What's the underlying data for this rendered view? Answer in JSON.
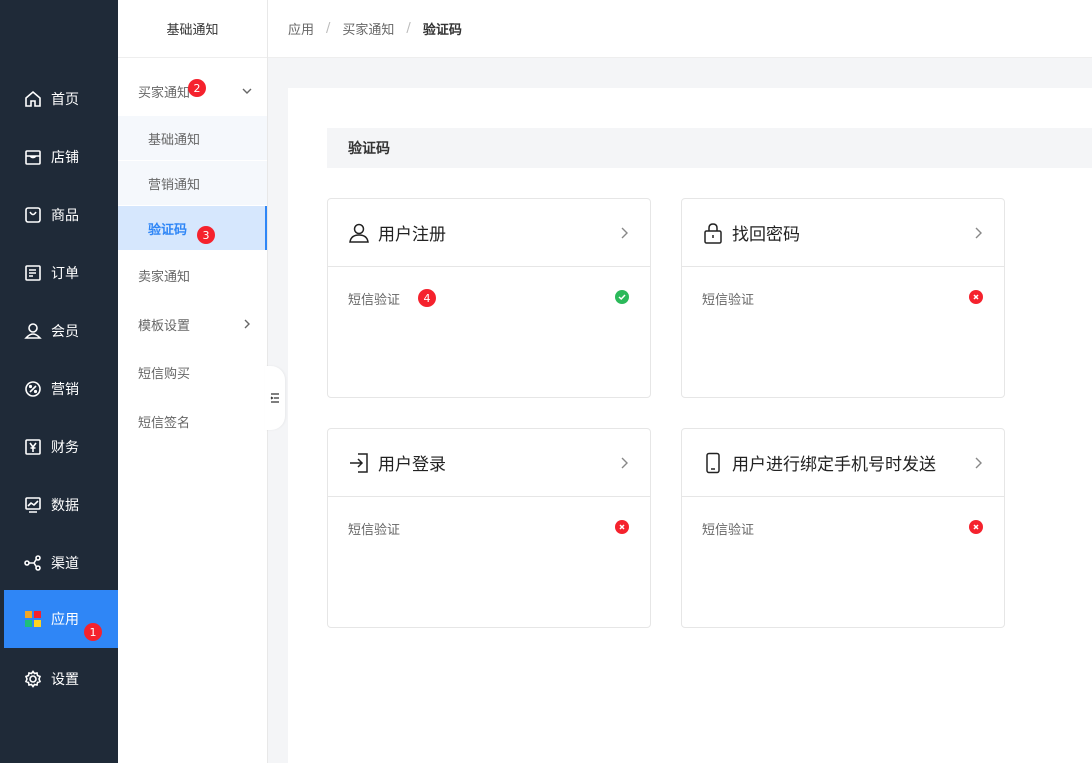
{
  "sidebar": {
    "items": [
      {
        "label": "首页",
        "icon": "home-icon"
      },
      {
        "label": "店铺",
        "icon": "store-icon"
      },
      {
        "label": "商品",
        "icon": "bag-icon"
      },
      {
        "label": "订单",
        "icon": "order-icon"
      },
      {
        "label": "会员",
        "icon": "user-icon"
      },
      {
        "label": "营销",
        "icon": "discount-icon"
      },
      {
        "label": "财务",
        "icon": "yuan-icon"
      },
      {
        "label": "数据",
        "icon": "chart-icon"
      },
      {
        "label": "渠道",
        "icon": "share-icon"
      },
      {
        "label": "应用",
        "icon": "apps-icon"
      },
      {
        "label": "设置",
        "icon": "gear-icon"
      }
    ],
    "active_index": 9,
    "accent": "#2f86f6",
    "background": "#1f2a38"
  },
  "subnav": {
    "header": "基础通知",
    "items": [
      {
        "label": "买家通知"
      },
      {
        "label": "基础通知"
      },
      {
        "label": "营销通知"
      },
      {
        "label": "验证码"
      },
      {
        "label": "卖家通知"
      },
      {
        "label": "模板设置"
      },
      {
        "label": "短信购买"
      },
      {
        "label": "短信签名"
      }
    ]
  },
  "breadcrumb": {
    "items": [
      "应用",
      "买家通知",
      "验证码"
    ],
    "separator": "/"
  },
  "badges": [
    "1",
    "2",
    "3",
    "4"
  ],
  "section": {
    "title": "验证码"
  },
  "cards": [
    {
      "title": "用户注册",
      "icon": "user-icon",
      "row_label": "短信验证",
      "status": "enabled"
    },
    {
      "title": "找回密码",
      "icon": "lock-icon",
      "row_label": "短信验证",
      "status": "disabled"
    },
    {
      "title": "用户登录",
      "icon": "login-icon",
      "row_label": "短信验证",
      "status": "disabled"
    },
    {
      "title": "用户进行绑定手机号时发送",
      "icon": "phone-icon",
      "row_label": "短信验证",
      "status": "disabled"
    }
  ],
  "colors": {
    "enabled": "#2bb95a",
    "disabled": "#f5222d",
    "badge": "#f5222d"
  }
}
